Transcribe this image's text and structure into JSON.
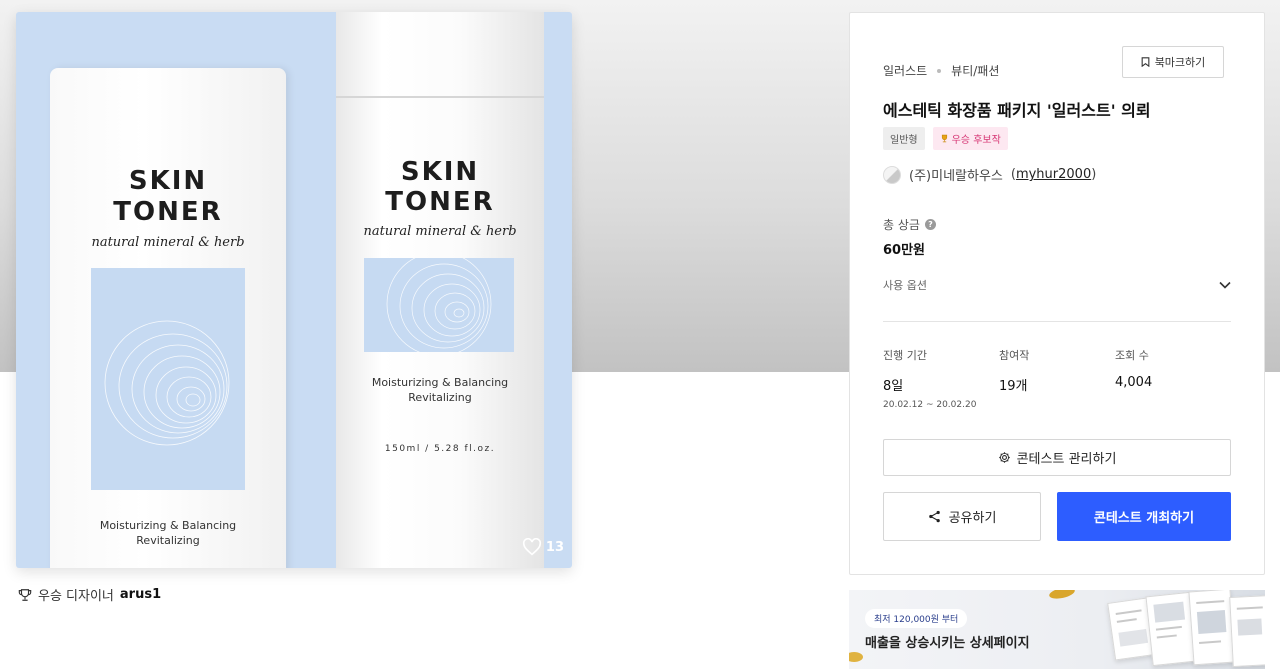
{
  "hero": {
    "left_product": {
      "brand_line1": "SKIN",
      "brand_line2": "TONER",
      "subtitle": "natural mineral & herb",
      "desc_line1": "Moisturizing & Balancing",
      "desc_line2": "Revitalizing"
    },
    "right_product": {
      "brand_line1": "SKIN",
      "brand_line2": "TONER",
      "subtitle": "natural mineral & herb",
      "desc_line1": "Moisturizing & Balancing",
      "desc_line2": "Revitalizing",
      "volume": "150ml / 5.28 fl.oz."
    },
    "likes": "13",
    "background_color": "#c9dcf3"
  },
  "winner": {
    "label": "우승 디자이너",
    "name": "arus1"
  },
  "card": {
    "bookmark_label": "북마크하기",
    "breadcrumbs": [
      "일러스트",
      "뷰티/패션"
    ],
    "title": "에스테틱 화장품 패키지 '일러스트' 의뢰",
    "tags": {
      "type": "일반형",
      "award": "우승 후보작"
    },
    "host": {
      "company": "(주)미네랄하우스",
      "user_id": "myhur2000"
    },
    "prize": {
      "label": "총 상금",
      "value": "60만원"
    },
    "usage_option_label": "사용 옵션",
    "stats": {
      "period": {
        "label": "진행 기간",
        "value": "8일",
        "range": "20.02.12 ~ 20.02.20"
      },
      "entries": {
        "label": "참여작",
        "value": "19개"
      },
      "views": {
        "label": "조회 수",
        "value": "4,004"
      }
    },
    "manage_label": "콘테스트 관리하기",
    "share_label": "공유하기",
    "host_contest_label": "콘테스트 개최하기",
    "accent_color": "#2d5dff"
  },
  "ad": {
    "pill": "최저 120,000원 부터",
    "text": "매출을 상승시키는 상세페이지"
  }
}
